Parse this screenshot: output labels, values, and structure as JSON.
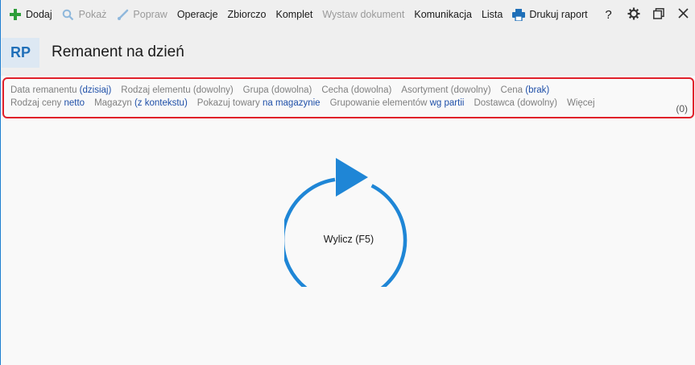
{
  "toolbar": {
    "add": "Dodaj",
    "show": "Pokaż",
    "edit": "Popraw",
    "operations": "Operacje",
    "aggregate": "Zbiorczo",
    "set": "Komplet",
    "issue_document": "Wystaw dokument",
    "communication": "Komunikacja",
    "list": "Lista",
    "print_report": "Drukuj raport",
    "help": "?"
  },
  "header": {
    "badge": "RP",
    "title": "Remanent na dzień"
  },
  "filters": {
    "row1": [
      {
        "label": "Data remanentu",
        "value": "(dzisiaj)",
        "highlight": true
      },
      {
        "label": "Rodzaj elementu",
        "value": "(dowolny)",
        "highlight": false
      },
      {
        "label": "Grupa",
        "value": "(dowolna)",
        "highlight": false
      },
      {
        "label": "Cecha",
        "value": "(dowolna)",
        "highlight": false
      },
      {
        "label": "Asortyment",
        "value": "(dowolny)",
        "highlight": false
      },
      {
        "label": "Cena",
        "value": "(brak)",
        "highlight": true
      }
    ],
    "row2": [
      {
        "label": "Rodzaj ceny",
        "value": "netto",
        "highlight": true
      },
      {
        "label": "Magazyn",
        "value": "(z kontekstu)",
        "highlight": true
      },
      {
        "label": "Pokazuj towary",
        "value": "na magazynie",
        "highlight": true
      },
      {
        "label": "Grupowanie elementów",
        "value": "wg partii",
        "highlight": true
      },
      {
        "label": "Dostawca",
        "value": "(dowolny)",
        "highlight": false
      },
      {
        "label": "Więcej",
        "value": "",
        "highlight": false
      }
    ],
    "count": "(0)"
  },
  "main": {
    "refresh_label": "Wylicz (F5)"
  },
  "colors": {
    "accent": "#1f86d6",
    "link": "#1e4fa8",
    "highlight_border": "#e0202a"
  }
}
